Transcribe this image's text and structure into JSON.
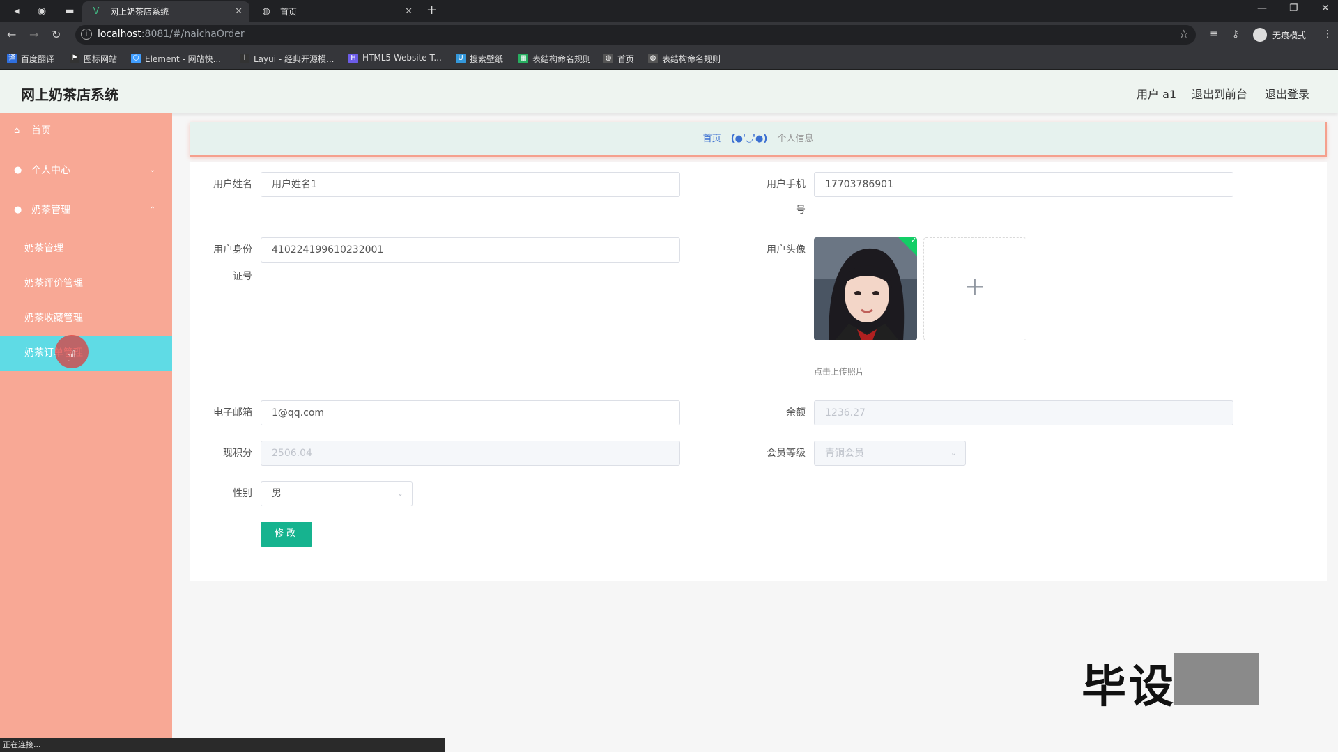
{
  "browser": {
    "tabs": [
      {
        "label": "网上奶茶店系统",
        "active": true
      },
      {
        "label": "首页",
        "active": false
      }
    ],
    "url_host": "localhost",
    "url_rest": ":8081/#/naichaOrder",
    "incognito_label": "无痕模式",
    "bookmarks": [
      "百度翻译",
      "图标网站",
      "Element - 网站快...",
      "Layui - 经典开源模...",
      "HTML5 Website T...",
      "搜索壁纸",
      "表结构命名规则",
      "首页",
      "表结构命名规则"
    ],
    "status_text": "正在连接..."
  },
  "header": {
    "title": "网上奶茶店系统",
    "user_label": "用户 a1",
    "back_front_label": "退出到前台",
    "logout_label": "退出登录"
  },
  "sidebar": {
    "home": "首页",
    "personal": "个人中心",
    "naicha_mgmt": "奶茶管理",
    "subs": [
      "奶茶管理",
      "奶茶评价管理",
      "奶茶收藏管理",
      "奶茶订单管理"
    ],
    "active_index": 3
  },
  "breadcrumb": {
    "home": "首页",
    "separator": "(●'◡'●)",
    "current": "个人信息"
  },
  "form": {
    "name_label": "用户姓名",
    "name_value": "用户姓名1",
    "phone_label_1": "用户手机",
    "phone_label_2": "号",
    "phone_value": "17703786901",
    "id_label_1": "用户身份",
    "id_label_2": "证号",
    "id_value": "410224199610232001",
    "avatar_label": "用户头像",
    "upload_tip": "点击上传照片",
    "email_label": "电子邮箱",
    "email_value": "1@qq.com",
    "balance_label": "余额",
    "balance_value": "1236.27",
    "points_label": "现积分",
    "points_value": "2506.04",
    "level_label": "会员等级",
    "level_value": "青铜会员",
    "gender_label": "性别",
    "gender_value": "男",
    "submit_label": "修改"
  },
  "watermark": "毕设"
}
